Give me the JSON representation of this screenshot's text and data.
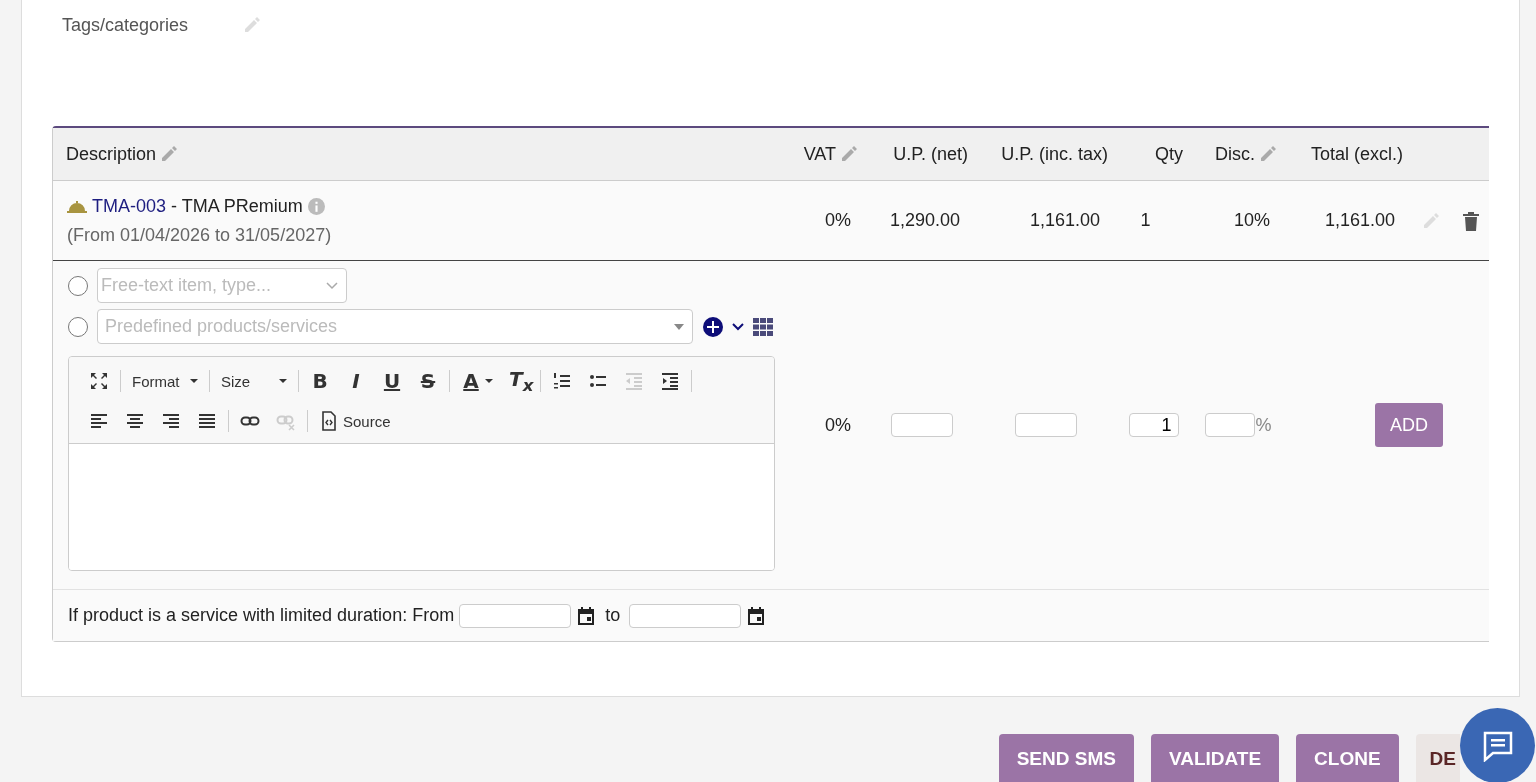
{
  "tags": {
    "label": "Tags/categories"
  },
  "table": {
    "columns": [
      {
        "label": "Description",
        "editable": true
      },
      {
        "label": "VAT",
        "editable": true
      },
      {
        "label": "U.P. (net)",
        "editable": false
      },
      {
        "label": "U.P. (inc. tax)",
        "editable": false
      },
      {
        "label": "Qty",
        "editable": false
      },
      {
        "label": "Disc.",
        "editable": true
      },
      {
        "label": "Total (excl.)",
        "editable": false
      }
    ],
    "rows": [
      {
        "ref": "TMA-003",
        "name": " - TMA PRemium",
        "period": "(From 01/04/2026 to 31/05/2027)",
        "vat": "0%",
        "unit_net": "1,290.00",
        "unit_inc": "1,161.00",
        "qty": "1",
        "discount": "10%",
        "total": "1,161.00"
      }
    ]
  },
  "add_line": {
    "options": [
      {
        "placeholder": "Free-text item, type...",
        "selected": false
      },
      {
        "placeholder": "Predefined products/services",
        "selected": false
      }
    ],
    "toolbar": [
      [
        {
          "kind": "maximize",
          "disabled": false
        },
        {
          "kind": "sep"
        },
        {
          "kind": "dropdown",
          "label": "Format",
          "disabled": false
        },
        {
          "kind": "sep"
        },
        {
          "kind": "dropdown",
          "label": "Size",
          "disabled": false
        },
        {
          "kind": "sep"
        },
        {
          "kind": "bold",
          "label": "B",
          "disabled": false
        },
        {
          "kind": "italic",
          "label": "I",
          "disabled": false
        },
        {
          "kind": "underline",
          "label": "U",
          "disabled": false
        },
        {
          "kind": "strike",
          "label": "S",
          "disabled": false
        },
        {
          "kind": "sep"
        },
        {
          "kind": "color",
          "label": "A",
          "disabled": false
        },
        {
          "kind": "clear",
          "label": "T$_{x}$",
          "disabled": false
        },
        {
          "kind": "sep"
        },
        {
          "kind": "numbered",
          "disabled": false
        },
        {
          "kind": "bulleted",
          "disabled": false
        },
        {
          "kind": "outdent",
          "disabled": true
        },
        {
          "kind": "indent",
          "disabled": false
        },
        {
          "kind": "sep"
        }
      ],
      [
        {
          "kind": "left",
          "disabled": false
        },
        {
          "kind": "center",
          "disabled": false
        },
        {
          "kind": "right",
          "disabled": false
        },
        {
          "kind": "justify",
          "disabled": false
        },
        {
          "kind": "sep"
        },
        {
          "kind": "link",
          "disabled": false
        },
        {
          "kind": "unlink",
          "disabled": true
        },
        {
          "kind": "sep"
        },
        {
          "kind": "source",
          "label": "Source",
          "disabled": false
        }
      ]
    ],
    "vat": "0%",
    "qty": "1",
    "percent": "%",
    "add_button": "ADD",
    "duration": {
      "label": "If product is a service with limited duration: From",
      "to": "to"
    }
  },
  "actions": [
    {
      "label": "SEND SMS",
      "kind": "primary"
    },
    {
      "label": "VALIDATE",
      "kind": "primary"
    },
    {
      "label": "CLONE",
      "kind": "primary"
    },
    {
      "label": "DE",
      "kind": "danger"
    }
  ]
}
